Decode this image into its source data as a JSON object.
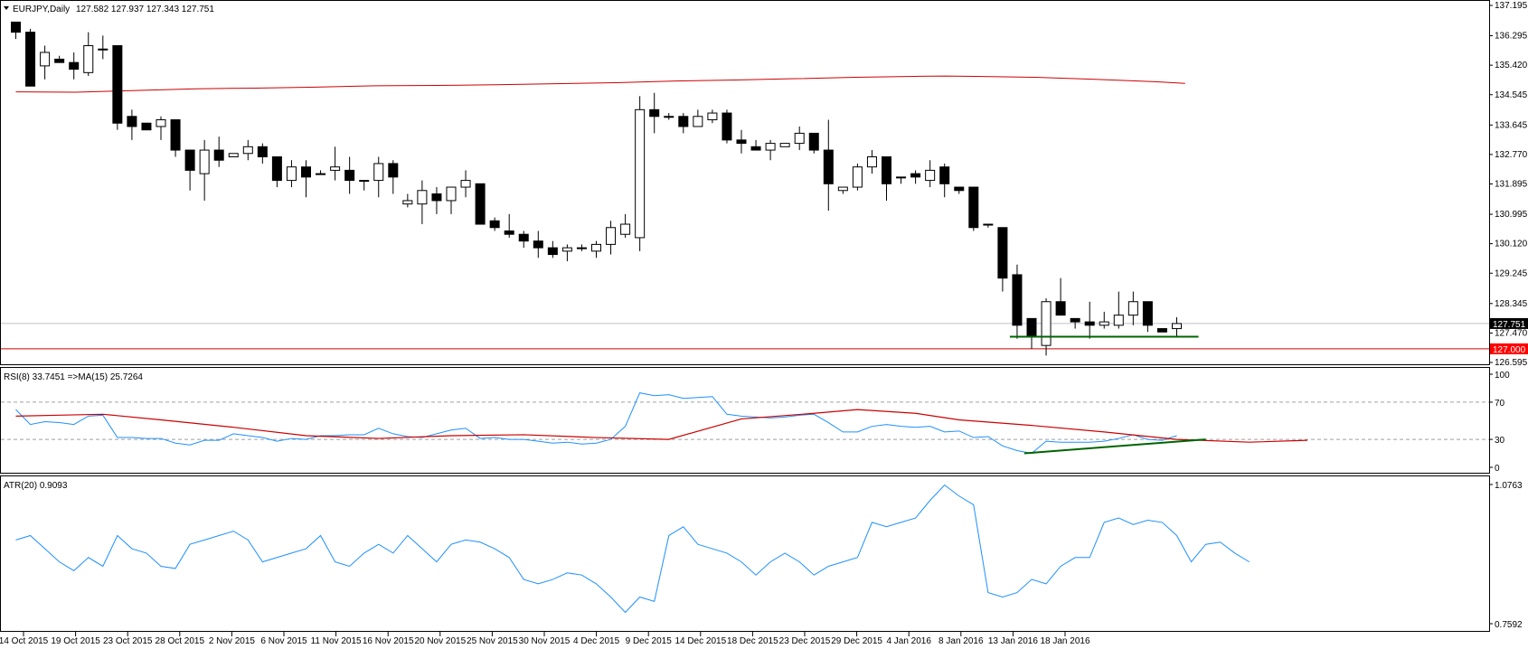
{
  "header": {
    "symbol": "EURJPY,Daily",
    "ohlc": "127.582 127.937 127.343 127.751",
    "rsi_label": "RSI(8) 33.7451  =>MA(15) 25.7264",
    "atr_label": "ATR(20) 0.9093"
  },
  "colors": {
    "bull_fill": "#ffffff",
    "bear_fill": "#000000",
    "ma_line": "#cc0000",
    "rsi_line": "#1e90ff",
    "atr_line": "#1e90ff",
    "support_line": "#006400",
    "level_line": "#cc0000",
    "current_tag": "#000000",
    "level_tag": "#ff0000"
  },
  "chart_data": [
    {
      "type": "candlestick",
      "panel": "price",
      "y_ticks": [
        "137.195",
        "136.295",
        "135.420",
        "134.545",
        "133.645",
        "132.770",
        "131.895",
        "130.995",
        "130.120",
        "129.245",
        "128.345",
        "127.470",
        "126.595"
      ],
      "ylim": [
        126.595,
        137.195
      ],
      "current_price": "127.751",
      "level_price": "127.000",
      "candles": [
        [
          136.7,
          136.4,
          136.7,
          136.2
        ],
        [
          136.4,
          134.8,
          136.5,
          134.8
        ],
        [
          135.4,
          135.8,
          136.0,
          135.0
        ],
        [
          135.6,
          135.5,
          135.7,
          135.5
        ],
        [
          135.5,
          135.3,
          135.8,
          135.0
        ],
        [
          135.2,
          136.0,
          136.4,
          135.1
        ],
        [
          135.9,
          135.9,
          136.3,
          135.6
        ],
        [
          136.0,
          133.7,
          136.0,
          133.5
        ],
        [
          133.9,
          133.6,
          134.1,
          133.2
        ],
        [
          133.7,
          133.5,
          133.7,
          133.5
        ],
        [
          133.6,
          133.8,
          133.9,
          133.2
        ],
        [
          133.8,
          132.9,
          133.8,
          132.7
        ],
        [
          132.9,
          132.3,
          132.9,
          131.7
        ],
        [
          132.2,
          132.9,
          133.2,
          131.4
        ],
        [
          132.9,
          132.6,
          133.3,
          132.4
        ],
        [
          132.7,
          132.8,
          132.8,
          132.7
        ],
        [
          132.8,
          133.0,
          133.2,
          132.6
        ],
        [
          133.0,
          132.7,
          133.1,
          132.5
        ],
        [
          132.7,
          132.0,
          132.7,
          131.8
        ],
        [
          132.0,
          132.4,
          132.6,
          131.8
        ],
        [
          132.4,
          132.1,
          132.6,
          131.5
        ],
        [
          132.2,
          132.2,
          132.3,
          132.2
        ],
        [
          132.3,
          132.4,
          133.0,
          132.0
        ],
        [
          132.3,
          132.0,
          132.7,
          131.6
        ],
        [
          132.0,
          132.0,
          132.0,
          131.7
        ],
        [
          132.0,
          132.5,
          132.7,
          131.5
        ],
        [
          132.5,
          132.1,
          132.6,
          131.6
        ],
        [
          131.3,
          131.4,
          131.6,
          131.2
        ],
        [
          131.3,
          131.7,
          132.0,
          130.7
        ],
        [
          131.6,
          131.4,
          131.8,
          131.0
        ],
        [
          131.4,
          131.8,
          131.8,
          131.0
        ],
        [
          131.8,
          132.0,
          132.3,
          131.5
        ],
        [
          131.9,
          130.7,
          131.9,
          130.7
        ],
        [
          130.8,
          130.6,
          130.9,
          130.5
        ],
        [
          130.5,
          130.4,
          131.0,
          130.3
        ],
        [
          130.4,
          130.2,
          130.5,
          130.0
        ],
        [
          130.2,
          130.0,
          130.5,
          129.7
        ],
        [
          130.0,
          129.8,
          130.2,
          129.7
        ],
        [
          129.9,
          130.0,
          130.1,
          129.6
        ],
        [
          130.0,
          130.0,
          130.1,
          129.9
        ],
        [
          129.9,
          130.1,
          130.2,
          129.7
        ],
        [
          130.1,
          130.6,
          130.8,
          129.8
        ],
        [
          130.4,
          130.7,
          131.0,
          130.3
        ],
        [
          130.3,
          134.1,
          134.5,
          129.9
        ],
        [
          134.1,
          133.9,
          134.6,
          133.4
        ],
        [
          133.9,
          133.9,
          134.0,
          133.8
        ],
        [
          133.9,
          133.6,
          134.0,
          133.4
        ],
        [
          133.6,
          133.9,
          134.1,
          133.6
        ],
        [
          133.8,
          134.0,
          134.1,
          133.7
        ],
        [
          134.0,
          133.2,
          134.1,
          133.1
        ],
        [
          133.2,
          133.1,
          133.5,
          132.8
        ],
        [
          133.0,
          132.9,
          133.2,
          132.9
        ],
        [
          132.9,
          133.1,
          133.2,
          132.6
        ],
        [
          133.0,
          133.1,
          133.1,
          133.0
        ],
        [
          133.1,
          133.4,
          133.6,
          132.9
        ],
        [
          133.4,
          132.9,
          133.4,
          132.8
        ],
        [
          132.9,
          131.9,
          133.8,
          131.1
        ],
        [
          131.7,
          131.8,
          131.8,
          131.6
        ],
        [
          131.8,
          132.4,
          132.5,
          131.7
        ],
        [
          132.4,
          132.7,
          132.9,
          132.2
        ],
        [
          132.7,
          131.9,
          132.7,
          131.4
        ],
        [
          132.1,
          132.1,
          132.1,
          131.9
        ],
        [
          132.2,
          132.1,
          132.3,
          131.9
        ],
        [
          132.0,
          132.3,
          132.6,
          131.8
        ],
        [
          132.4,
          131.9,
          132.5,
          131.5
        ],
        [
          131.8,
          131.7,
          131.8,
          131.6
        ],
        [
          131.8,
          130.6,
          131.8,
          130.5
        ],
        [
          130.7,
          130.7,
          130.7,
          130.6
        ],
        [
          130.6,
          129.1,
          130.6,
          128.7
        ],
        [
          129.2,
          127.7,
          129.5,
          127.3
        ],
        [
          127.9,
          127.4,
          127.9,
          127.0
        ],
        [
          127.1,
          128.4,
          128.5,
          126.8
        ],
        [
          128.4,
          128.0,
          129.1,
          128.0
        ],
        [
          127.9,
          127.8,
          127.9,
          127.6
        ],
        [
          127.8,
          127.7,
          128.4,
          127.3
        ],
        [
          127.7,
          127.8,
          128.1,
          127.6
        ],
        [
          127.7,
          128.0,
          128.7,
          127.6
        ],
        [
          128.0,
          128.4,
          128.7,
          127.7
        ],
        [
          128.4,
          127.7,
          128.4,
          127.5
        ],
        [
          127.6,
          127.5,
          127.6,
          127.5
        ],
        [
          127.6,
          127.751,
          127.937,
          127.343
        ]
      ],
      "ma_line": [
        [
          0,
          134.63
        ],
        [
          10,
          134.62
        ],
        [
          20,
          134.67
        ],
        [
          30,
          134.72
        ],
        [
          40,
          134.74
        ],
        [
          50,
          134.77
        ],
        [
          60,
          134.81
        ],
        [
          70,
          134.82
        ],
        [
          80,
          134.84
        ],
        [
          90,
          134.87
        ],
        [
          100,
          134.9
        ],
        [
          110,
          134.95
        ],
        [
          120,
          134.98
        ],
        [
          130,
          135.02
        ],
        [
          140,
          135.06
        ],
        [
          150,
          135.09
        ],
        [
          155,
          135.1
        ],
        [
          160,
          135.09
        ],
        [
          170,
          135.06
        ],
        [
          180,
          135.0
        ],
        [
          190,
          134.93
        ],
        [
          195,
          134.88
        ]
      ],
      "support_line": [
        [
          68.5,
          127.36
        ],
        [
          81.5,
          127.36
        ]
      ],
      "x_ticks": [
        "14 Oct 2015",
        "19 Oct 2015",
        "23 Oct 2015",
        "28 Oct 2015",
        "2 Nov 2015",
        "6 Nov 2015",
        "11 Nov 2015",
        "16 Nov 2015",
        "20 Nov 2015",
        "25 Nov 2015",
        "30 Nov 2015",
        "4 Dec 2015",
        "9 Dec 2015",
        "14 Dec 2015",
        "18 Dec 2015",
        "23 Dec 2015",
        "29 Dec 2015",
        "4 Jan 2016",
        "8 Jan 2016",
        "13 Jan 2016",
        "18 Jan 2016"
      ]
    },
    {
      "type": "line",
      "panel": "rsi",
      "name": "RSI(8)",
      "ylim": [
        0,
        100
      ],
      "y_ticks": [
        "100",
        "70",
        "30",
        "0"
      ],
      "levels": [
        70,
        30
      ],
      "values": [
        62,
        46,
        49,
        48,
        46,
        55,
        56,
        32,
        32,
        31,
        31,
        26,
        24,
        29,
        29,
        36,
        34,
        32,
        28,
        31,
        30,
        34,
        34,
        35,
        35,
        42,
        36,
        33,
        32,
        36,
        40,
        42,
        31,
        32,
        30,
        30,
        28,
        26,
        27,
        25,
        26,
        30,
        44,
        80,
        77,
        78,
        74,
        75,
        76,
        57,
        55,
        54,
        53,
        54,
        56,
        57,
        48,
        38,
        38,
        44,
        46,
        44,
        43,
        44,
        38,
        39,
        32,
        33,
        23,
        18,
        15,
        28,
        27,
        27,
        27,
        28,
        31,
        35,
        30,
        29,
        34
      ],
      "ma_values": [
        [
          0,
          55
        ],
        [
          3,
          56
        ],
        [
          6,
          57
        ],
        [
          10,
          51
        ],
        [
          15,
          43
        ],
        [
          20,
          34
        ],
        [
          25,
          31
        ],
        [
          30,
          34
        ],
        [
          35,
          35
        ],
        [
          40,
          32
        ],
        [
          45,
          30
        ],
        [
          50,
          52
        ],
        [
          55,
          58
        ],
        [
          58,
          62
        ],
        [
          62,
          58
        ],
        [
          65,
          51
        ],
        [
          70,
          45
        ],
        [
          75,
          38
        ],
        [
          80,
          30
        ],
        [
          85,
          27
        ],
        [
          89,
          29
        ]
      ],
      "trend_line": [
        [
          69.5,
          15
        ],
        [
          82,
          30
        ]
      ]
    },
    {
      "type": "line",
      "panel": "atr",
      "name": "ATR(20)",
      "ylim": [
        0.7592,
        1.0763
      ],
      "y_ticks": [
        "1.0763",
        "0.7592"
      ],
      "values": [
        0.95,
        0.96,
        0.93,
        0.9,
        0.88,
        0.91,
        0.89,
        0.96,
        0.93,
        0.92,
        0.89,
        0.885,
        0.94,
        0.95,
        0.96,
        0.97,
        0.95,
        0.9,
        0.91,
        0.92,
        0.93,
        0.96,
        0.9,
        0.89,
        0.92,
        0.94,
        0.92,
        0.96,
        0.93,
        0.9,
        0.94,
        0.95,
        0.945,
        0.93,
        0.91,
        0.86,
        0.85,
        0.86,
        0.875,
        0.87,
        0.85,
        0.82,
        0.785,
        0.82,
        0.81,
        0.96,
        0.98,
        0.94,
        0.93,
        0.92,
        0.9,
        0.87,
        0.9,
        0.92,
        0.9,
        0.87,
        0.89,
        0.9,
        0.91,
        0.99,
        0.98,
        0.99,
        1.0,
        1.04,
        1.075,
        1.05,
        1.03,
        0.83,
        0.82,
        0.83,
        0.86,
        0.85,
        0.89,
        0.91,
        0.91,
        0.99,
        1.0,
        0.985,
        0.995,
        0.99,
        0.96,
        0.9,
        0.94,
        0.945,
        0.92,
        0.9
      ]
    }
  ]
}
